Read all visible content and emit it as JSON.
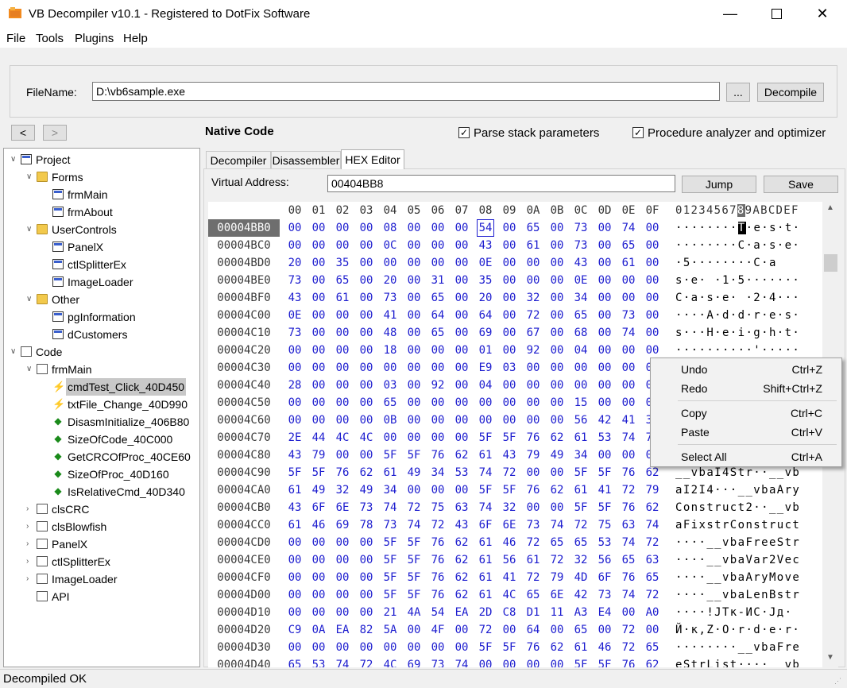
{
  "window": {
    "title": "VB Decompiler v10.1 - Registered to DotFix Software"
  },
  "menu": [
    "File",
    "Tools",
    "Plugins",
    "Help"
  ],
  "file": {
    "label": "FileName:",
    "value": "D:\\vb6sample.exe",
    "browse": "...",
    "decompile": "Decompile"
  },
  "nav": {
    "back": "<",
    "forward": ">",
    "mode": "Native Code"
  },
  "options": {
    "parse_stack": {
      "label": "Parse stack parameters",
      "checked": true
    },
    "optimizer": {
      "label": "Procedure analyzer and optimizer",
      "checked": true
    }
  },
  "tree": [
    {
      "label": "Project",
      "icon": "project-icon",
      "exp": "minus"
    },
    {
      "label": "Forms",
      "icon": "folder-icon",
      "exp": "minus"
    },
    {
      "label": "frmMain",
      "icon": "form-icon"
    },
    {
      "label": "frmAbout",
      "icon": "form-icon"
    },
    {
      "label": "UserControls",
      "icon": "folder-icon",
      "exp": "minus"
    },
    {
      "label": "PanelX",
      "icon": "usercontrol-icon"
    },
    {
      "label": "ctlSplitterEx",
      "icon": "usercontrol-icon"
    },
    {
      "label": "ImageLoader",
      "icon": "usercontrol-icon"
    },
    {
      "label": "Other",
      "icon": "folder-icon",
      "exp": "minus"
    },
    {
      "label": "pgInformation",
      "icon": "propertypage-icon"
    },
    {
      "label": "dCustomers",
      "icon": "designer-icon"
    },
    {
      "label": "Code",
      "icon": "code-icon",
      "exp": "minus"
    },
    {
      "label": "frmMain",
      "icon": "module-icon",
      "exp": "minus"
    },
    {
      "label": "cmdTest_Click_40D450",
      "icon": "event-icon",
      "selected": true
    },
    {
      "label": "txtFile_Change_40D990",
      "icon": "event-icon"
    },
    {
      "label": "DisasmInitialize_406B80",
      "icon": "procedure-icon"
    },
    {
      "label": "SizeOfCode_40C000",
      "icon": "procedure-icon"
    },
    {
      "label": "GetCRCOfProc_40CE60",
      "icon": "procedure-icon"
    },
    {
      "label": "SizeOfProc_40D160",
      "icon": "procedure-icon"
    },
    {
      "label": "IsRelativeCmd_40D340",
      "icon": "procedure-icon"
    },
    {
      "label": "clsCRC",
      "icon": "module-icon",
      "exp": "plus"
    },
    {
      "label": "clsBlowfish",
      "icon": "module-icon",
      "exp": "plus"
    },
    {
      "label": "PanelX",
      "icon": "module-icon",
      "exp": "plus"
    },
    {
      "label": "ctlSplitterEx",
      "icon": "module-icon",
      "exp": "plus"
    },
    {
      "label": "ImageLoader",
      "icon": "module-icon",
      "exp": "plus"
    },
    {
      "label": "API",
      "icon": "api-icon"
    }
  ],
  "tabs": [
    {
      "label": "Decompiler",
      "active": false
    },
    {
      "label": "Disassembler",
      "active": false
    },
    {
      "label": "HEX Editor",
      "active": true
    }
  ],
  "hex": {
    "va_label": "Virtual Address:",
    "va_value": "00404BB8",
    "jump": "Jump",
    "save": "Save",
    "header_bytes": [
      "00",
      "01",
      "02",
      "03",
      "04",
      "05",
      "06",
      "07",
      "08",
      "09",
      "0A",
      "0B",
      "0C",
      "0D",
      "0E",
      "0F"
    ],
    "header_ascii": "0123456789ABCDEF",
    "rows": [
      {
        "addr": "00004BB0",
        "bytes": "00 00 00 00 08 00 00 00 54 00 65 00 73 00 74 00",
        "ascii": "········T·e·s·t·"
      },
      {
        "addr": "00004BC0",
        "bytes": "00 00 00 00 0C 00 00 00 43 00 61 00 73 00 65 00",
        "ascii": "········C·a·s·e·"
      },
      {
        "addr": "00004BD0",
        "bytes": "20 00 35 00 00 00 00 00 0E 00 00 00 43 00 61 00",
        "ascii": "·5········C·a"
      },
      {
        "addr": "00004BE0",
        "bytes": "73 00 65 00 20 00 31 00 35 00 00 00 0E 00 00 00",
        "ascii": "s·e· ·1·5·······"
      },
      {
        "addr": "00004BF0",
        "bytes": "43 00 61 00 73 00 65 00 20 00 32 00 34 00 00 00",
        "ascii": "C·a·s·e· ·2·4···"
      },
      {
        "addr": "00004C00",
        "bytes": "0E 00 00 00 41 00 64 00 64 00 72 00 65 00 73 00",
        "ascii": "····A·d·d·r·e·s·"
      },
      {
        "addr": "00004C10",
        "bytes": "73 00 00 00 48 00 65 00 69 00 67 00 68 00 74 00",
        "ascii": "s···H·e·i·g·h·t·"
      },
      {
        "addr": "00004C20",
        "bytes": "00 00 00 00 18 00 00 00 01 00 92 00 04 00 00 00",
        "ascii": "··········'·····"
      },
      {
        "addr": "00004C30",
        "bytes": "00 00 00 00 00 00 00 00 E9 03 00 00 00 00 00 00",
        "ascii": ""
      },
      {
        "addr": "00004C40",
        "bytes": "28 00 00 00 03 00 92 00 04 00 00 00 00 00 00 00",
        "ascii": ""
      },
      {
        "addr": "00004C50",
        "bytes": "00 00 00 00 65 00 00 00 00 00 00 00 15 00 00 00",
        "ascii": ""
      },
      {
        "addr": "00004C60",
        "bytes": "00 00 00 00 0B 00 00 00 00 00 00 00 56 42 41 36",
        "ascii": ""
      },
      {
        "addr": "00004C70",
        "bytes": "2E 44 4C 4C 00 00 00 00 5F 5F 76 62 61 53 74 72",
        "ascii": ""
      },
      {
        "addr": "00004C80",
        "bytes": "43 79 00 00 5F 5F 76 62 61 43 79 49 34 00 00 00",
        "ascii": ""
      },
      {
        "addr": "00004C90",
        "bytes": "5F 5F 76 62 61 49 34 53 74 72 00 00 5F 5F 76 62",
        "ascii": "__vbaI4Str··__vb"
      },
      {
        "addr": "00004CA0",
        "bytes": "61 49 32 49 34 00 00 00 5F 5F 76 62 61 41 72 79",
        "ascii": "aI2I4···__vbaAry"
      },
      {
        "addr": "00004CB0",
        "bytes": "43 6F 6E 73 74 72 75 63 74 32 00 00 5F 5F 76 62",
        "ascii": "Construct2··__vb"
      },
      {
        "addr": "00004CC0",
        "bytes": "61 46 69 78 73 74 72 43 6F 6E 73 74 72 75 63 74",
        "ascii": "aFixstrConstruct"
      },
      {
        "addr": "00004CD0",
        "bytes": "00 00 00 00 5F 5F 76 62 61 46 72 65 65 53 74 72",
        "ascii": "····__vbaFreeStr"
      },
      {
        "addr": "00004CE0",
        "bytes": "00 00 00 00 5F 5F 76 62 61 56 61 72 32 56 65 63",
        "ascii": "····__vbaVar2Vec"
      },
      {
        "addr": "00004CF0",
        "bytes": "00 00 00 00 5F 5F 76 62 61 41 72 79 4D 6F 76 65",
        "ascii": "····__vbaAryMove"
      },
      {
        "addr": "00004D00",
        "bytes": "00 00 00 00 5F 5F 76 62 61 4C 65 6E 42 73 74 72",
        "ascii": "····__vbaLenBstr"
      },
      {
        "addr": "00004D10",
        "bytes": "00 00 00 00 21 4A 54 EA 2D C8 D1 11 A3 E4 00 A0",
        "ascii": "····!JTк-ИС·Jд·"
      },
      {
        "addr": "00004D20",
        "bytes": "C9 0A EA 82 5A 00 4F 00 72 00 64 00 65 00 72 00",
        "ascii": "Й·к,Z·O·r·d·e·r·"
      },
      {
        "addr": "00004D30",
        "bytes": "00 00 00 00 00 00 00 00 5F 5F 76 62 61 46 72 65",
        "ascii": "········__vbaFre"
      },
      {
        "addr": "00004D40",
        "bytes": "65 53 74 72 4C 69 73 74 00 00 00 00 5F 5F 76 62",
        "ascii": "eStrList····__vb"
      }
    ]
  },
  "context_menu": [
    {
      "label": "Undo",
      "shortcut": "Ctrl+Z"
    },
    {
      "label": "Redo",
      "shortcut": "Shift+Ctrl+Z"
    },
    {
      "label": "Copy",
      "shortcut": "Ctrl+C"
    },
    {
      "label": "Paste",
      "shortcut": "Ctrl+V"
    },
    {
      "label": "Select All",
      "shortcut": "Ctrl+A"
    }
  ],
  "status": "Decompiled OK",
  "colors": {
    "hex_bytes": "#1c1ccf",
    "selection_gray": "#6e6e6e",
    "folder": "#f2c94c"
  }
}
